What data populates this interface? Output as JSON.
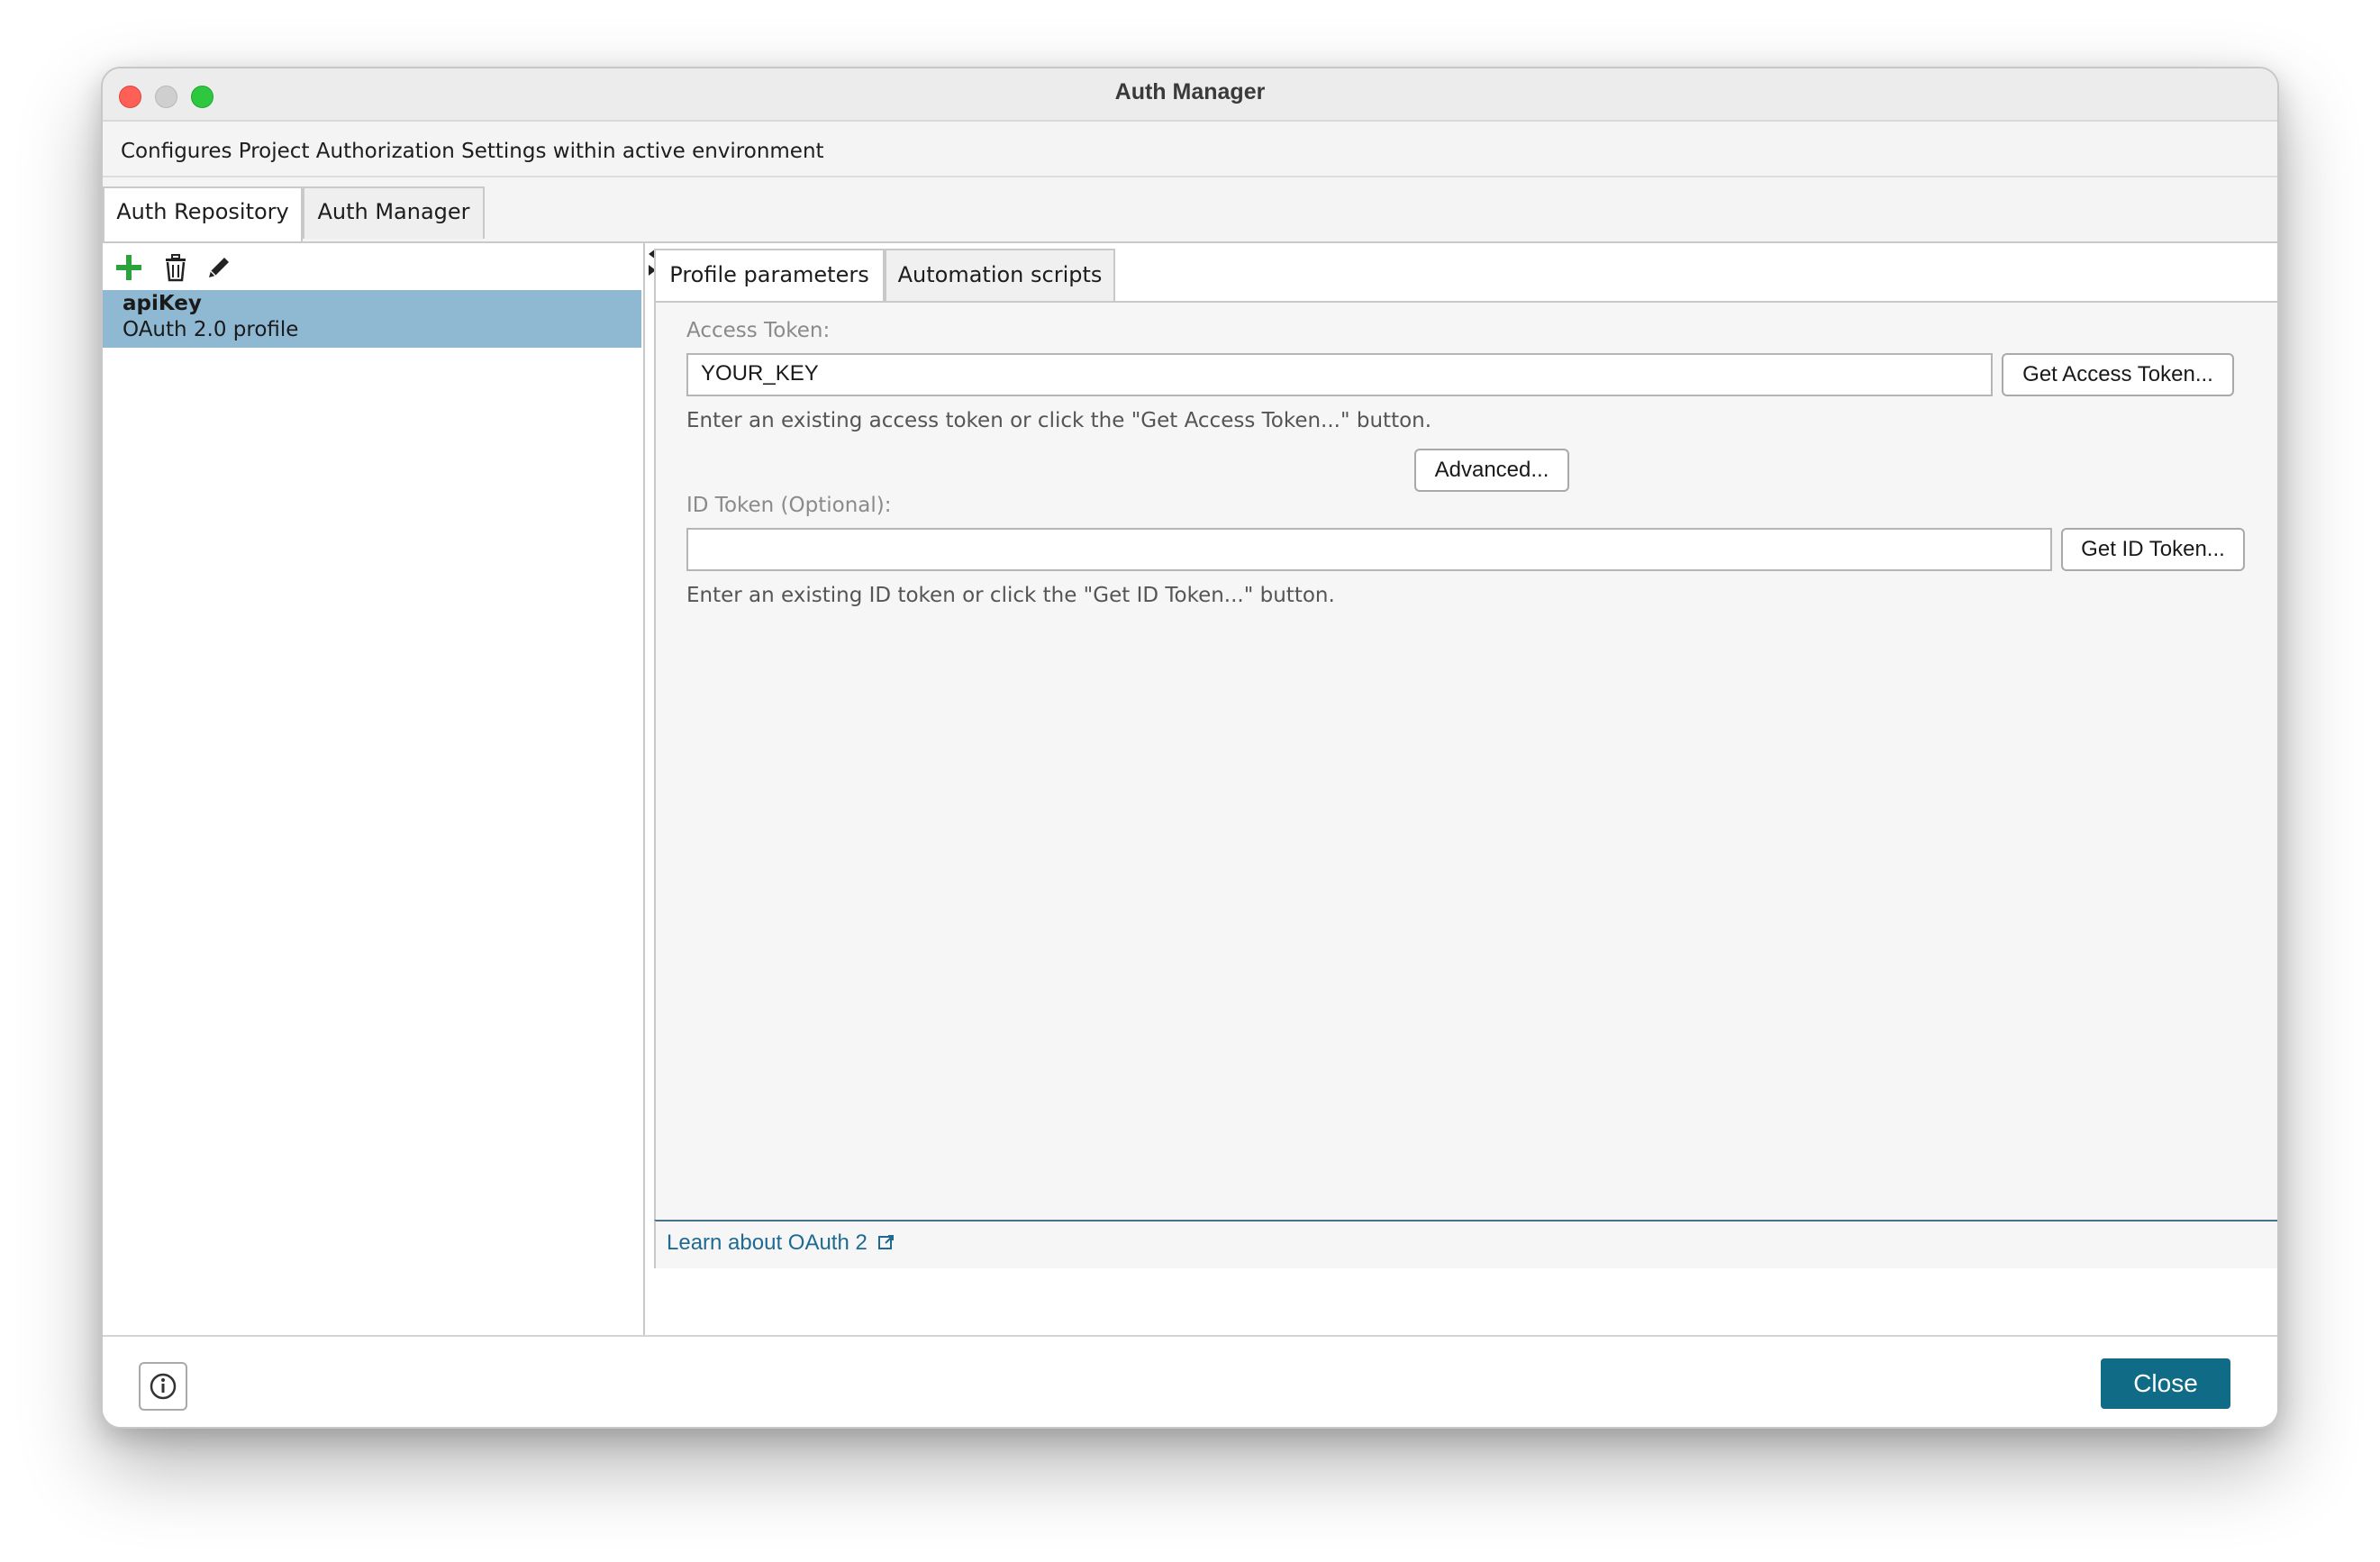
{
  "window": {
    "title": "Auth Manager"
  },
  "description": "Configures Project Authorization Settings within active environment",
  "top_tabs": [
    {
      "label": "Auth Repository",
      "active": true
    },
    {
      "label": "Auth Manager",
      "active": false
    }
  ],
  "toolbar": {
    "add_icon": "plus-icon",
    "delete_icon": "trash-icon",
    "edit_icon": "pencil-icon",
    "add_color": "#2aa33c"
  },
  "profiles": [
    {
      "name": "apiKey",
      "type": "OAuth 2.0 profile",
      "selected": true
    }
  ],
  "sub_tabs": [
    {
      "label": "Profile parameters",
      "active": true
    },
    {
      "label": "Automation scripts",
      "active": false
    }
  ],
  "form": {
    "access_token": {
      "label": "Access Token:",
      "value": "YOUR_KEY",
      "button": "Get Access Token...",
      "hint": "Enter an existing access token or click the \"Get Access Token...\" button."
    },
    "advanced_button": "Advanced...",
    "id_token": {
      "label": "ID Token (Optional):",
      "value": "",
      "button": "Get ID Token...",
      "hint": "Enter an existing ID token or click the \"Get ID Token...\" button."
    }
  },
  "link": {
    "label": "Learn about OAuth 2",
    "icon": "external-link-icon"
  },
  "footer": {
    "info_icon": "info-icon",
    "close_label": "Close",
    "close_color": "#0f6b86"
  }
}
